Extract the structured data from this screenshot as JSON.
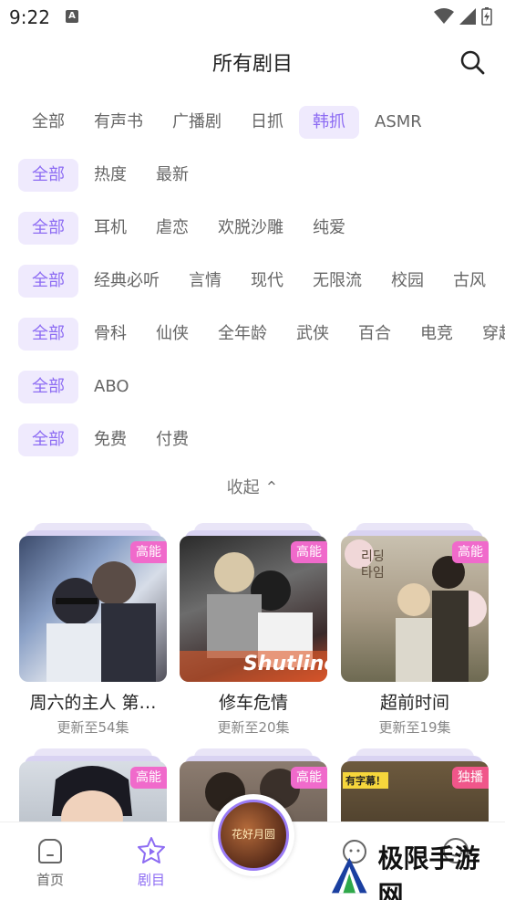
{
  "status_bar": {
    "time": "9:22"
  },
  "header": {
    "title": "所有剧目"
  },
  "filters": {
    "row1": [
      "全部",
      "有声书",
      "广播剧",
      "日抓",
      "韩抓",
      "ASMR"
    ],
    "row2": [
      "全部",
      "热度",
      "最新"
    ],
    "row3": [
      "全部",
      "耳机",
      "虐恋",
      "欢脱沙雕",
      "纯爱"
    ],
    "row4": [
      "全部",
      "经典必听",
      "言情",
      "现代",
      "无限流",
      "校园",
      "古风"
    ],
    "row5": [
      "全部",
      "骨科",
      "仙侠",
      "全年龄",
      "武侠",
      "百合",
      "电竞",
      "穿越"
    ],
    "row6": [
      "全部",
      "ABO"
    ],
    "row7": [
      "全部",
      "免费",
      "付费"
    ]
  },
  "collapse_label": "收起 ⌃",
  "cards": [
    {
      "title": "周六的主人 第…",
      "update": "更新至54集",
      "badge": "高能",
      "badge_color": "#f06acb"
    },
    {
      "title": "修车危情",
      "update": "更新至20集",
      "badge": "高能",
      "badge_color": "#f06acb"
    },
    {
      "title": "超前时间",
      "update": "更新至19集",
      "badge": "高能",
      "badge_color": "#f06acb"
    },
    {
      "title": "",
      "update": "",
      "badge": "高能",
      "badge_color": "#f06acb"
    },
    {
      "title": "",
      "update": "",
      "badge": "高能",
      "badge_color": "#f06acb"
    },
    {
      "title": "",
      "update": "",
      "badge": "独播",
      "badge_color": "#f0568a"
    }
  ],
  "cover_text": {
    "card2": "Shutline",
    "card3": "리딩타임",
    "card6": "有字幕！"
  },
  "tabbar": {
    "home": "首页",
    "shows": "剧目",
    "center_disc": "花好月圆"
  },
  "watermark": {
    "text": "极限手游网"
  },
  "colors": {
    "accent": "#8d6cf3",
    "chip_active_bg": "#efeafd",
    "badge_pink": "#f06acb"
  }
}
